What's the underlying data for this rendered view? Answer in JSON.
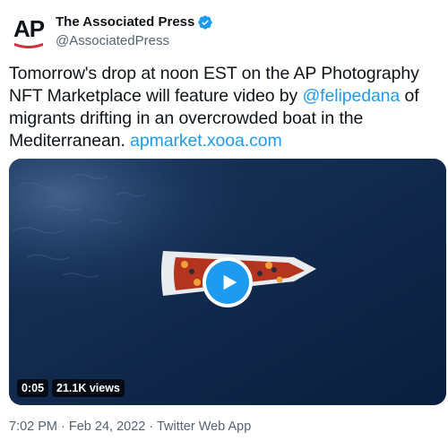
{
  "author": {
    "display_name": "The Associated Press",
    "handle": "@AssociatedPress",
    "avatar_text": "AP",
    "verified_icon": "verified-badge-icon"
  },
  "tweet": {
    "text_part1": "Tomorrow's drop at noon EST on the AP Photography NFT Marketplace will feature video by ",
    "mention": "@felipedana",
    "text_part2": " of migrants drifting in an overcrowded boat in the Mediterranean. ",
    "link": "apmarket.xooa.com"
  },
  "media": {
    "type": "video",
    "duration": "0:05",
    "views": "21.1K views",
    "play_icon": "play-icon"
  },
  "footer": {
    "meta": "7:02 PM · Feb 24, 2022 · Twitter Web App"
  },
  "colors": {
    "accent": "#1d9bf0",
    "text": "#0f1419",
    "secondary": "#536471",
    "sea": "#0d2547",
    "logo_red": "#e0263a"
  }
}
